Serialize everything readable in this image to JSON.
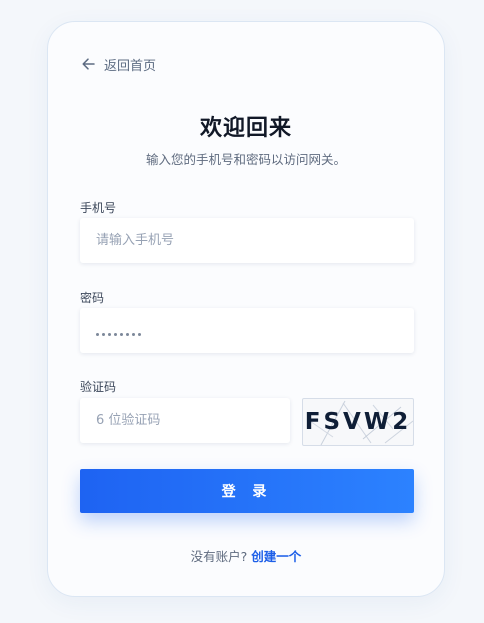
{
  "nav": {
    "back_label": "返回首页"
  },
  "header": {
    "title": "欢迎回来",
    "subtitle": "输入您的手机号和密码以访问网关。"
  },
  "form": {
    "phone": {
      "label": "手机号",
      "placeholder": "请输入手机号",
      "value": ""
    },
    "password": {
      "label": "密码",
      "masked_length": 8
    },
    "captcha": {
      "label": "验证码",
      "placeholder": "6 位验证码",
      "code": "FSVW2"
    },
    "submit_label": "登 录"
  },
  "footer": {
    "prompt": "没有账户?",
    "link_label": "创建一个"
  },
  "colors": {
    "accent": "#1e63f2",
    "accent_end": "#2c82ff",
    "link": "#1d5fe8",
    "page_bg": "#f4f7fb"
  }
}
